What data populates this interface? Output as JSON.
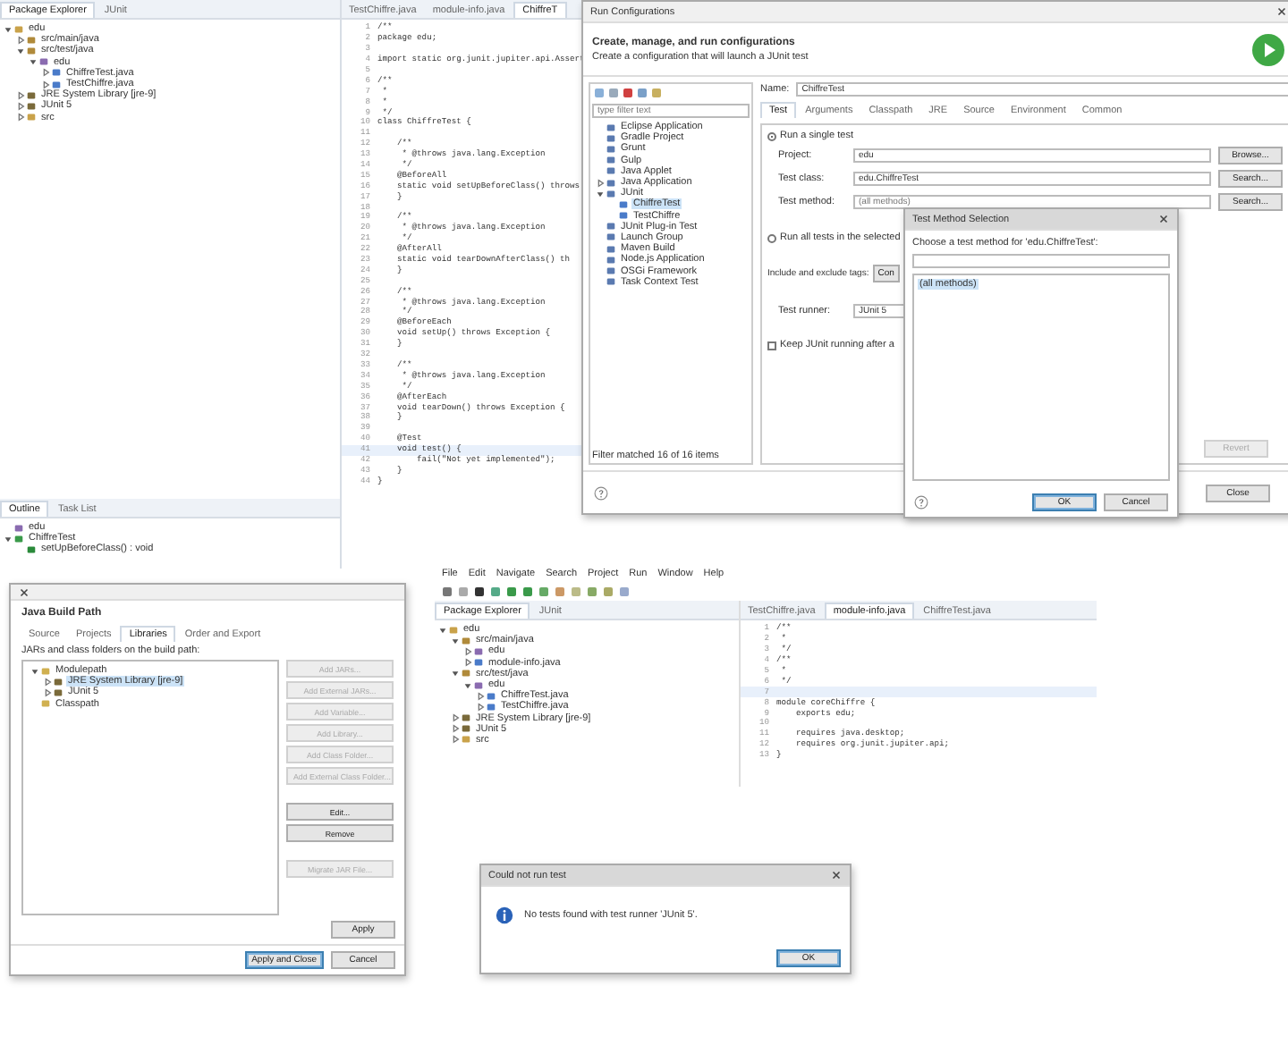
{
  "ide_top": {
    "explorer": {
      "tabs": [
        {
          "label": "Package Explorer",
          "selected": true
        },
        {
          "label": "JUnit",
          "selected": false
        }
      ],
      "tree": [
        {
          "label": "edu",
          "kind": "project",
          "expanded": true,
          "children": [
            {
              "label": "src/main/java",
              "kind": "folder",
              "expanded": false
            },
            {
              "label": "src/test/java",
              "kind": "folder",
              "expanded": true,
              "children": [
                {
                  "label": "edu",
                  "kind": "package",
                  "expanded": true,
                  "children": [
                    {
                      "label": "ChiffreTest.java",
                      "kind": "file",
                      "expanded": false
                    },
                    {
                      "label": "TestChiffre.java",
                      "kind": "file",
                      "expanded": false
                    }
                  ]
                }
              ]
            },
            {
              "label": "JRE System Library [jre-9]",
              "kind": "library",
              "expanded": false
            },
            {
              "label": "JUnit 5",
              "kind": "library",
              "expanded": false
            },
            {
              "label": "src",
              "kind": "project",
              "expanded": false
            }
          ]
        }
      ]
    },
    "editor": {
      "tabs": [
        {
          "label": "TestChiffre.java",
          "selected": false
        },
        {
          "label": "module-info.java",
          "selected": false
        },
        {
          "label": "ChiffreT",
          "selected": true
        }
      ],
      "lines": [
        {
          "number": "1",
          "text": "/**"
        },
        {
          "number": "2",
          "text": "package edu;"
        },
        {
          "number": "3"
        },
        {
          "number": "4",
          "text": "import static org.junit.jupiter.api.Assert"
        },
        {
          "number": "5"
        },
        {
          "number": "6",
          "text": "/**"
        },
        {
          "number": "7",
          "text": " *"
        },
        {
          "number": "8",
          "text": " *"
        },
        {
          "number": "9",
          "text": " */"
        },
        {
          "number": "10",
          "text": "class ChiffreTest {"
        },
        {
          "number": "11"
        },
        {
          "number": "12",
          "text": "    /**"
        },
        {
          "number": "13",
          "text": "     * @throws java.lang.Exception"
        },
        {
          "number": "14",
          "text": "     */"
        },
        {
          "number": "15",
          "text": "    @BeforeAll"
        },
        {
          "number": "16",
          "text": "    static void setUpBeforeClass() throws"
        },
        {
          "number": "17",
          "text": "    }"
        },
        {
          "number": "18"
        },
        {
          "number": "19",
          "text": "    /**"
        },
        {
          "number": "20",
          "text": "     * @throws java.lang.Exception"
        },
        {
          "number": "21",
          "text": "     */"
        },
        {
          "number": "22",
          "text": "    @AfterAll"
        },
        {
          "number": "23",
          "text": "    static void tearDownAfterClass() th"
        },
        {
          "number": "24",
          "text": "    }"
        },
        {
          "number": "25"
        },
        {
          "number": "26",
          "text": "    /**"
        },
        {
          "number": "27",
          "text": "     * @throws java.lang.Exception"
        },
        {
          "number": "28",
          "text": "     */"
        },
        {
          "number": "29",
          "text": "    @BeforeEach"
        },
        {
          "number": "30",
          "text": "    void setUp() throws Exception {"
        },
        {
          "number": "31",
          "text": "    }"
        },
        {
          "number": "32"
        },
        {
          "number": "33",
          "text": "    /**"
        },
        {
          "number": "34",
          "text": "     * @throws java.lang.Exception"
        },
        {
          "number": "35",
          "text": "     */"
        },
        {
          "number": "36",
          "text": "    @AfterEach"
        },
        {
          "number": "37",
          "text": "    void tearDown() throws Exception {"
        },
        {
          "number": "38",
          "text": "    }"
        },
        {
          "number": "39"
        },
        {
          "number": "40",
          "text": "    @Test"
        },
        {
          "number": "41",
          "text": "    void test() {"
        },
        {
          "number": "42",
          "text": "        fail(\"Not yet implemented\");"
        },
        {
          "number": "43",
          "text": "    }"
        },
        {
          "number": "44",
          "text": "}"
        }
      ]
    },
    "outline": {
      "tabs": [
        {
          "label": "Outline",
          "selected": true
        },
        {
          "label": "Task List",
          "selected": false
        }
      ],
      "tree": [
        {
          "label": "edu",
          "kind": "package"
        },
        {
          "label": "ChiffreTest",
          "kind": "class",
          "expanded": true,
          "children": [
            {
              "label": "setUpBeforeClass() : void",
              "kind": "method"
            }
          ]
        }
      ]
    }
  },
  "run_configurations": {
    "title": "Run Configurations",
    "heading": "Create, manage, and run configurations",
    "subtitle": "Create a configuration that will launch a JUnit test",
    "filter": {
      "placeholder": "type filter text"
    },
    "tree": [
      {
        "label": "Eclipse Application",
        "kind": "launch"
      },
      {
        "label": "Gradle Project",
        "kind": "launch"
      },
      {
        "label": "Grunt",
        "kind": "launch"
      },
      {
        "label": "Gulp",
        "kind": "launch"
      },
      {
        "label": "Java Applet",
        "kind": "launch"
      },
      {
        "label": "Java Application",
        "kind": "launch",
        "expanded": false
      },
      {
        "label": "JUnit",
        "kind": "launch",
        "expanded": true,
        "children": [
          {
            "label": "ChiffreTest",
            "kind": "file",
            "selected": true
          },
          {
            "label": "TestChiffre",
            "kind": "file",
            "selected": false
          }
        ]
      },
      {
        "label": "JUnit Plug-in Test",
        "kind": "launch"
      },
      {
        "label": "Launch Group",
        "kind": "launch"
      },
      {
        "label": "Maven Build",
        "kind": "launch"
      },
      {
        "label": "Node.js Application",
        "kind": "launch"
      },
      {
        "label": "OSGi Framework",
        "kind": "launch"
      },
      {
        "label": "Task Context Test",
        "kind": "launch"
      }
    ],
    "footer": "Filter matched 16 of 16 items",
    "name_label": "Name:",
    "name": "ChiffreTest",
    "tabs": [
      {
        "label": "Test",
        "selected": true
      },
      {
        "label": "Arguments",
        "selected": false
      },
      {
        "label": "Classpath",
        "selected": false
      },
      {
        "label": "JRE",
        "selected": false
      },
      {
        "label": "Source",
        "selected": false
      },
      {
        "label": "Environment",
        "selected": false
      },
      {
        "label": "Common",
        "selected": false
      }
    ],
    "single_test": {
      "label": "Run a single test",
      "selected": true
    },
    "fields": [
      {
        "label": "Project:",
        "value": "edu",
        "button": "Browse..."
      },
      {
        "label": "Test class:",
        "value": "edu.ChiffreTest",
        "button": "Search..."
      },
      {
        "label": "Test method:",
        "placeholder": "(all methods)",
        "button": "Search..."
      }
    ],
    "all_tests": {
      "label": "Run all tests in the selected",
      "selected": false
    },
    "tags_label": "Include and exclude tags:",
    "tags_button": "Con",
    "runner_label": "Test runner:",
    "runner": "JUnit 5",
    "keep_running": {
      "label": "Keep JUnit running after a",
      "checked": false
    },
    "revert": "Revert",
    "close": "Close"
  },
  "test_method_selection": {
    "title": "Test Method Selection",
    "prompt": "Choose a test method for 'edu.ChiffreTest':",
    "items": [
      {
        "label": "(all methods)",
        "selected": true
      }
    ],
    "buttons": [
      "OK",
      "Cancel"
    ]
  },
  "java_build_path": {
    "title": "Java Build Path",
    "tabs": [
      {
        "label": "Source",
        "selected": false
      },
      {
        "label": "Projects",
        "selected": false
      },
      {
        "label": "Libraries",
        "selected": true
      },
      {
        "label": "Order and Export",
        "selected": false
      }
    ],
    "caption": "JARs and class folders on the build path:",
    "tree": [
      {
        "label": "Modulepath",
        "kind": "group",
        "expanded": true,
        "children": [
          {
            "label": "JRE System Library [jre-9]",
            "kind": "library",
            "expanded": false,
            "selected": true
          },
          {
            "label": "JUnit 5",
            "kind": "library",
            "expanded": false,
            "selected": false
          }
        ]
      },
      {
        "label": "Classpath",
        "kind": "group",
        "selected": false
      }
    ],
    "buttons": [
      {
        "label": "Add JARs...",
        "disabled": true
      },
      {
        "label": "Add External JARs...",
        "disabled": true
      },
      {
        "label": "Add Variable...",
        "disabled": true
      },
      {
        "label": "Add Library...",
        "disabled": true
      },
      {
        "label": "Add Class Folder...",
        "disabled": true
      },
      {
        "label": "Add External Class Folder...",
        "disabled": true
      },
      {
        "label": "Edit...",
        "disabled": false
      },
      {
        "label": "Remove",
        "disabled": false
      },
      {
        "label": "Migrate JAR File...",
        "disabled": true
      }
    ],
    "apply": "Apply",
    "apply_close": "Apply and Close",
    "cancel": "Cancel"
  },
  "ide_bottom": {
    "menu": [
      "File",
      "Edit",
      "Navigate",
      "Search",
      "Project",
      "Run",
      "Window",
      "Help"
    ],
    "explorer": {
      "tabs": [
        {
          "label": "Package Explorer",
          "selected": true
        },
        {
          "label": "JUnit",
          "selected": false
        }
      ],
      "tree": [
        {
          "label": "edu",
          "kind": "project",
          "expanded": true,
          "children": [
            {
              "label": "src/main/java",
              "kind": "folder",
              "expanded": true,
              "children": [
                {
                  "label": "edu",
                  "kind": "package",
                  "expanded": false
                },
                {
                  "label": "module-info.java",
                  "kind": "file",
                  "expanded": false
                }
              ]
            },
            {
              "label": "src/test/java",
              "kind": "folder",
              "expanded": true,
              "children": [
                {
                  "label": "edu",
                  "kind": "package",
                  "expanded": true,
                  "children": [
                    {
                      "label": "ChiffreTest.java",
                      "kind": "file",
                      "expanded": false
                    },
                    {
                      "label": "TestChiffre.java",
                      "kind": "file",
                      "expanded": false
                    }
                  ]
                }
              ]
            },
            {
              "label": "JRE System Library [jre-9]",
              "kind": "library",
              "expanded": false
            },
            {
              "label": "JUnit 5",
              "kind": "library",
              "expanded": false
            },
            {
              "label": "src",
              "kind": "project",
              "expanded": false
            }
          ]
        }
      ]
    },
    "editor": {
      "tabs": [
        {
          "label": "TestChiffre.java",
          "selected": false
        },
        {
          "label": "module-info.java",
          "selected": true
        },
        {
          "label": "ChiffreTest.java",
          "selected": false
        }
      ],
      "lines": [
        {
          "number": "1",
          "text": "/**"
        },
        {
          "number": "2",
          "text": " *"
        },
        {
          "number": "3",
          "text": " */"
        },
        {
          "number": "4",
          "text": "/**"
        },
        {
          "number": "5",
          "text": " *"
        },
        {
          "number": "6",
          "text": " */"
        },
        {
          "number": "7"
        },
        {
          "number": "8",
          "text": "module coreChiffre {"
        },
        {
          "number": "9",
          "text": "    exports edu;"
        },
        {
          "number": "10"
        },
        {
          "number": "11",
          "text": "    requires java.desktop;"
        },
        {
          "number": "12",
          "text": "    requires org.junit.jupiter.api;"
        },
        {
          "number": "13",
          "text": "}"
        }
      ]
    }
  },
  "message_dialog": {
    "title": "Could not run test",
    "message": "No tests found with test runner 'JUnit 5'.",
    "button": "OK"
  }
}
